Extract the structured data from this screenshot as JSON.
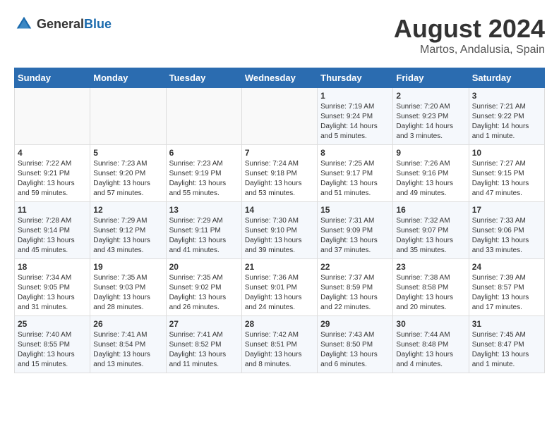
{
  "header": {
    "logo_general": "General",
    "logo_blue": "Blue",
    "month_year": "August 2024",
    "location": "Martos, Andalusia, Spain"
  },
  "weekdays": [
    "Sunday",
    "Monday",
    "Tuesday",
    "Wednesday",
    "Thursday",
    "Friday",
    "Saturday"
  ],
  "weeks": [
    [
      {
        "day": "",
        "info": ""
      },
      {
        "day": "",
        "info": ""
      },
      {
        "day": "",
        "info": ""
      },
      {
        "day": "",
        "info": ""
      },
      {
        "day": "1",
        "info": "Sunrise: 7:19 AM\nSunset: 9:24 PM\nDaylight: 14 hours\nand 5 minutes."
      },
      {
        "day": "2",
        "info": "Sunrise: 7:20 AM\nSunset: 9:23 PM\nDaylight: 14 hours\nand 3 minutes."
      },
      {
        "day": "3",
        "info": "Sunrise: 7:21 AM\nSunset: 9:22 PM\nDaylight: 14 hours\nand 1 minute."
      }
    ],
    [
      {
        "day": "4",
        "info": "Sunrise: 7:22 AM\nSunset: 9:21 PM\nDaylight: 13 hours\nand 59 minutes."
      },
      {
        "day": "5",
        "info": "Sunrise: 7:23 AM\nSunset: 9:20 PM\nDaylight: 13 hours\nand 57 minutes."
      },
      {
        "day": "6",
        "info": "Sunrise: 7:23 AM\nSunset: 9:19 PM\nDaylight: 13 hours\nand 55 minutes."
      },
      {
        "day": "7",
        "info": "Sunrise: 7:24 AM\nSunset: 9:18 PM\nDaylight: 13 hours\nand 53 minutes."
      },
      {
        "day": "8",
        "info": "Sunrise: 7:25 AM\nSunset: 9:17 PM\nDaylight: 13 hours\nand 51 minutes."
      },
      {
        "day": "9",
        "info": "Sunrise: 7:26 AM\nSunset: 9:16 PM\nDaylight: 13 hours\nand 49 minutes."
      },
      {
        "day": "10",
        "info": "Sunrise: 7:27 AM\nSunset: 9:15 PM\nDaylight: 13 hours\nand 47 minutes."
      }
    ],
    [
      {
        "day": "11",
        "info": "Sunrise: 7:28 AM\nSunset: 9:14 PM\nDaylight: 13 hours\nand 45 minutes."
      },
      {
        "day": "12",
        "info": "Sunrise: 7:29 AM\nSunset: 9:12 PM\nDaylight: 13 hours\nand 43 minutes."
      },
      {
        "day": "13",
        "info": "Sunrise: 7:29 AM\nSunset: 9:11 PM\nDaylight: 13 hours\nand 41 minutes."
      },
      {
        "day": "14",
        "info": "Sunrise: 7:30 AM\nSunset: 9:10 PM\nDaylight: 13 hours\nand 39 minutes."
      },
      {
        "day": "15",
        "info": "Sunrise: 7:31 AM\nSunset: 9:09 PM\nDaylight: 13 hours\nand 37 minutes."
      },
      {
        "day": "16",
        "info": "Sunrise: 7:32 AM\nSunset: 9:07 PM\nDaylight: 13 hours\nand 35 minutes."
      },
      {
        "day": "17",
        "info": "Sunrise: 7:33 AM\nSunset: 9:06 PM\nDaylight: 13 hours\nand 33 minutes."
      }
    ],
    [
      {
        "day": "18",
        "info": "Sunrise: 7:34 AM\nSunset: 9:05 PM\nDaylight: 13 hours\nand 31 minutes."
      },
      {
        "day": "19",
        "info": "Sunrise: 7:35 AM\nSunset: 9:03 PM\nDaylight: 13 hours\nand 28 minutes."
      },
      {
        "day": "20",
        "info": "Sunrise: 7:35 AM\nSunset: 9:02 PM\nDaylight: 13 hours\nand 26 minutes."
      },
      {
        "day": "21",
        "info": "Sunrise: 7:36 AM\nSunset: 9:01 PM\nDaylight: 13 hours\nand 24 minutes."
      },
      {
        "day": "22",
        "info": "Sunrise: 7:37 AM\nSunset: 8:59 PM\nDaylight: 13 hours\nand 22 minutes."
      },
      {
        "day": "23",
        "info": "Sunrise: 7:38 AM\nSunset: 8:58 PM\nDaylight: 13 hours\nand 20 minutes."
      },
      {
        "day": "24",
        "info": "Sunrise: 7:39 AM\nSunset: 8:57 PM\nDaylight: 13 hours\nand 17 minutes."
      }
    ],
    [
      {
        "day": "25",
        "info": "Sunrise: 7:40 AM\nSunset: 8:55 PM\nDaylight: 13 hours\nand 15 minutes."
      },
      {
        "day": "26",
        "info": "Sunrise: 7:41 AM\nSunset: 8:54 PM\nDaylight: 13 hours\nand 13 minutes."
      },
      {
        "day": "27",
        "info": "Sunrise: 7:41 AM\nSunset: 8:52 PM\nDaylight: 13 hours\nand 11 minutes."
      },
      {
        "day": "28",
        "info": "Sunrise: 7:42 AM\nSunset: 8:51 PM\nDaylight: 13 hours\nand 8 minutes."
      },
      {
        "day": "29",
        "info": "Sunrise: 7:43 AM\nSunset: 8:50 PM\nDaylight: 13 hours\nand 6 minutes."
      },
      {
        "day": "30",
        "info": "Sunrise: 7:44 AM\nSunset: 8:48 PM\nDaylight: 13 hours\nand 4 minutes."
      },
      {
        "day": "31",
        "info": "Sunrise: 7:45 AM\nSunset: 8:47 PM\nDaylight: 13 hours\nand 1 minute."
      }
    ]
  ]
}
